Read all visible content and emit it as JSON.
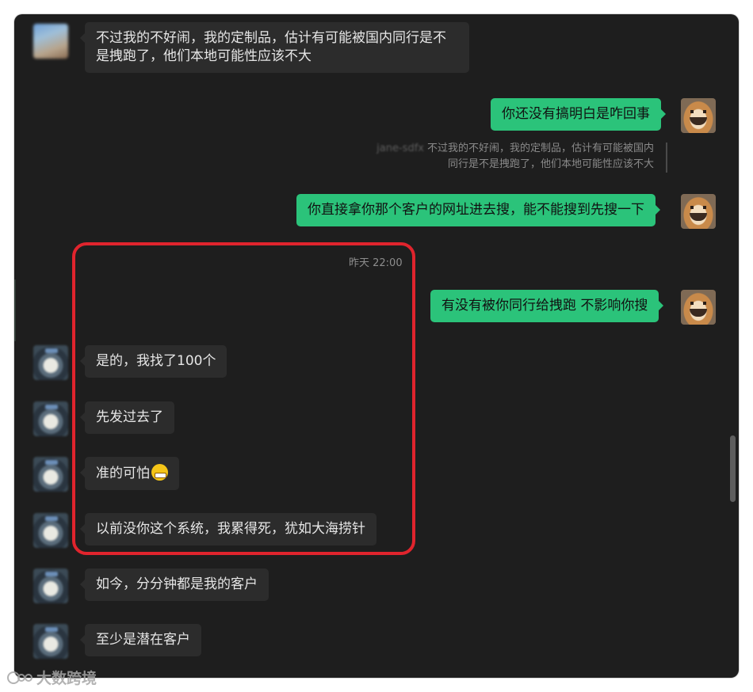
{
  "messages": [
    {
      "side": "in",
      "text": "不过我的不好闹，我的定制品，估计有可能被国内同行是不是拽跑了，他们本地可能性应该不大"
    },
    {
      "side": "out",
      "text": "你还没有搞明白是咋回事"
    },
    {
      "quote_name": "jane-sdfx",
      "quote_text": "不过我的不好闹，我的定制品，估计有可能被国内同行是不是拽跑了，他们本地可能性应该不大"
    },
    {
      "side": "out",
      "text": "你直接拿你那个客户的网址进去搜，能不能搜到先搜一下"
    },
    {
      "side": "out",
      "text": "有没有被你同行给拽跑 不影响你搜"
    },
    {
      "side": "in",
      "text": "是的，我找了100个"
    },
    {
      "side": "in",
      "text": "先发过去了"
    },
    {
      "side": "in",
      "text": "准的可怕"
    },
    {
      "side": "in",
      "text": "以前没你这个系统，我累得死，犹如大海捞针"
    },
    {
      "side": "in",
      "text": "如今，分分钟都是我的客户"
    },
    {
      "side": "in",
      "text": "至少是潜在客户"
    }
  ],
  "timestamp": "昨天 22:00",
  "emoji": "grinning-face-emoji",
  "watermark": "大数跨境",
  "colors": {
    "background": "#1e1e1e",
    "incoming_bubble": "#2c2c2c",
    "outgoing_bubble": "#2bc37a",
    "highlight": "#e0242d"
  }
}
